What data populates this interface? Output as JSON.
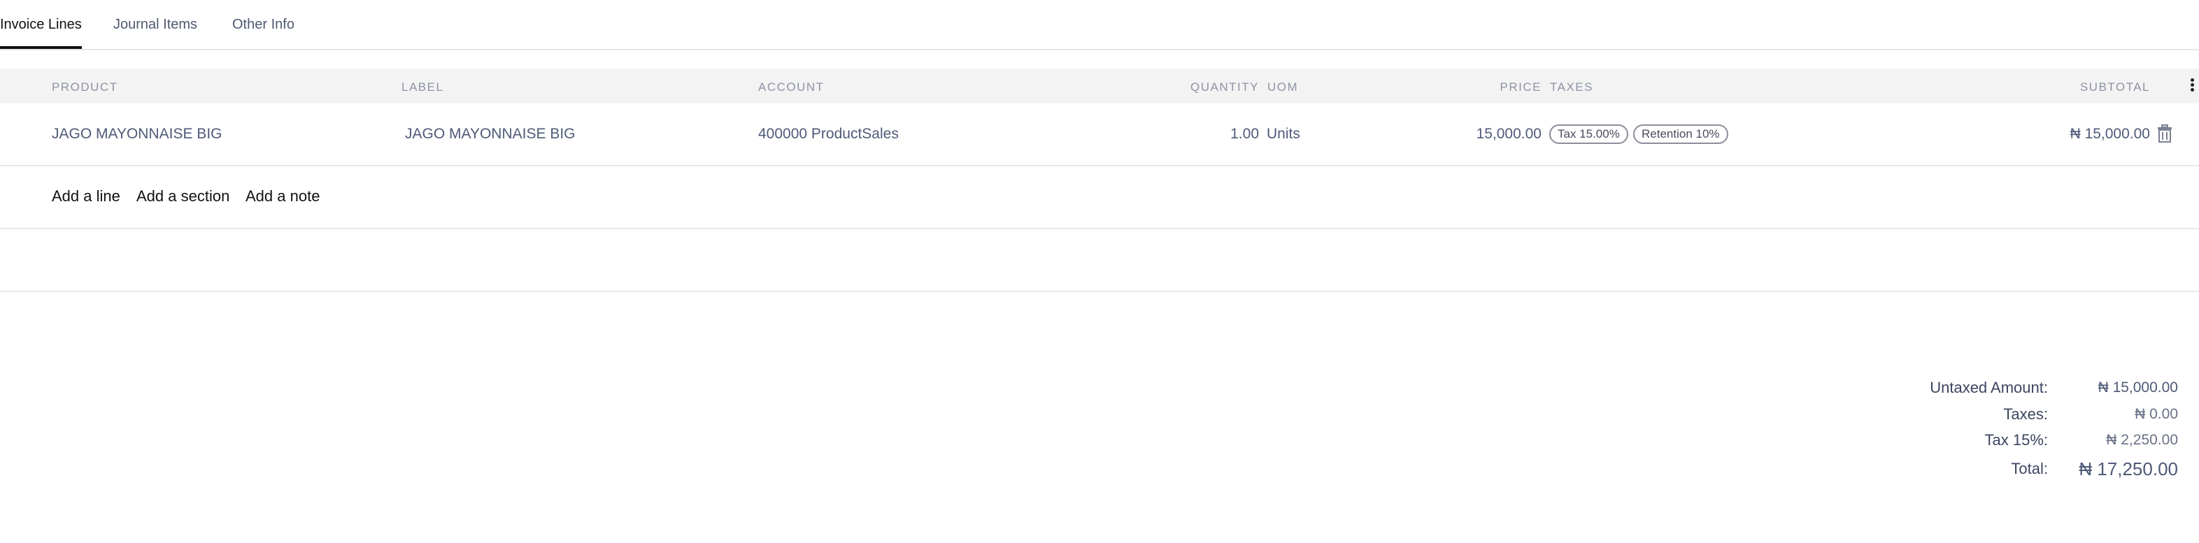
{
  "tabs": [
    {
      "label": "Invoice Lines",
      "active": true
    },
    {
      "label": "Journal Items",
      "active": false
    },
    {
      "label": "Other Info",
      "active": false
    }
  ],
  "table": {
    "columns": [
      "PRODUCT",
      "LABEL",
      "ACCOUNT",
      "QUANTITY",
      "UOM",
      "PRICE",
      "TAXES",
      "SUBTOTAL"
    ],
    "rows": [
      {
        "product": "JAGO MAYONNAISE BIG",
        "label": "JAGO MAYONNAISE BIG",
        "account": "400000 ProductSales",
        "quantity": "1.00",
        "uom": "Units",
        "price": "15,000.00",
        "taxes": [
          "Tax 15.00%",
          "Retention 10%"
        ],
        "subtotal": "₦ 15,000.00"
      }
    ]
  },
  "actions": {
    "add_line": "Add a line",
    "add_section": "Add a section",
    "add_note": "Add a note"
  },
  "totals": {
    "untaxed_label": "Untaxed Amount:",
    "untaxed_value": "₦ 15,000.00",
    "taxes_label": "Taxes:",
    "taxes_value": "₦ 0.00",
    "tax15_label": "Tax 15%:",
    "tax15_value": "₦ 2,250.00",
    "total_label": "Total:",
    "total_value": "₦ 17,250.00"
  },
  "icons": {
    "row_delete": "trash-icon",
    "column_options": "kebab-menu-icon"
  }
}
